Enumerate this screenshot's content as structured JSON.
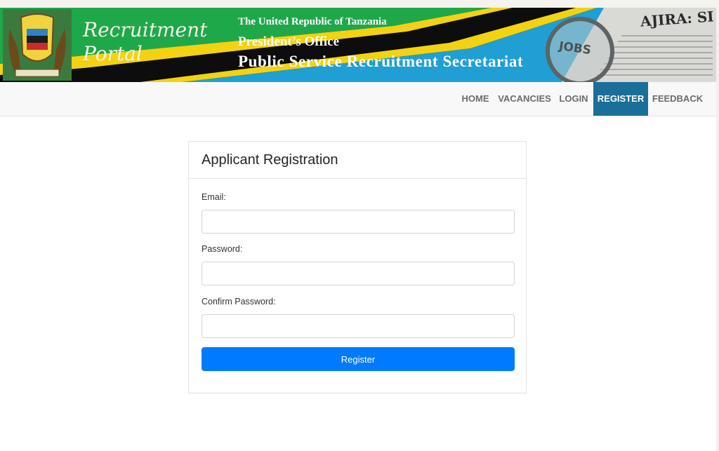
{
  "banner": {
    "portal_title_line1": "Recruitment",
    "portal_title_line2": "Portal",
    "republic": "The United Republic of Tanzania",
    "office": "President’s Office",
    "secretariat": "Public Service Recruitment Secretariat",
    "newspaper_text": "AJIRA: SI",
    "jobs_text": "JOBS",
    "colors": {
      "green": "#1fa84a",
      "yellow": "#f3d211",
      "black": "#0d0d0d",
      "blue": "#1f9fd4"
    }
  },
  "nav": {
    "items": [
      {
        "label": "HOME",
        "active": false
      },
      {
        "label": "VACANCIES",
        "active": false
      },
      {
        "label": "LOGIN",
        "active": false
      },
      {
        "label": "REGISTER",
        "active": true
      },
      {
        "label": "FEEDBACK",
        "active": false
      }
    ],
    "active_color": "#1a6f98"
  },
  "form": {
    "title": "Applicant Registration",
    "email_label": "Email:",
    "email_value": "",
    "password_label": "Password:",
    "password_value": "",
    "confirm_label": "Confirm Password:",
    "confirm_value": "",
    "submit_label": "Register",
    "submit_color": "#007bff"
  }
}
